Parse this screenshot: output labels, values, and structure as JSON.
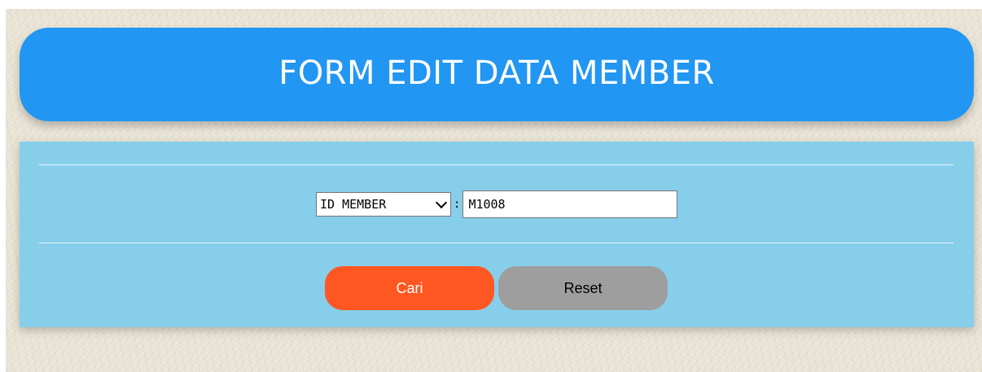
{
  "header": {
    "title": "FORM EDIT DATA MEMBER"
  },
  "search": {
    "field_select": {
      "selected": "ID MEMBER"
    },
    "separator": ":",
    "value": "M1008"
  },
  "actions": {
    "search_label": "Cari",
    "reset_label": "Reset"
  },
  "colors": {
    "header_bg": "#2196f3",
    "panel_bg": "#87ceeb",
    "search_button": "#ff5722",
    "reset_button": "#9e9e9e",
    "page_bg": "#e9e4d6"
  }
}
